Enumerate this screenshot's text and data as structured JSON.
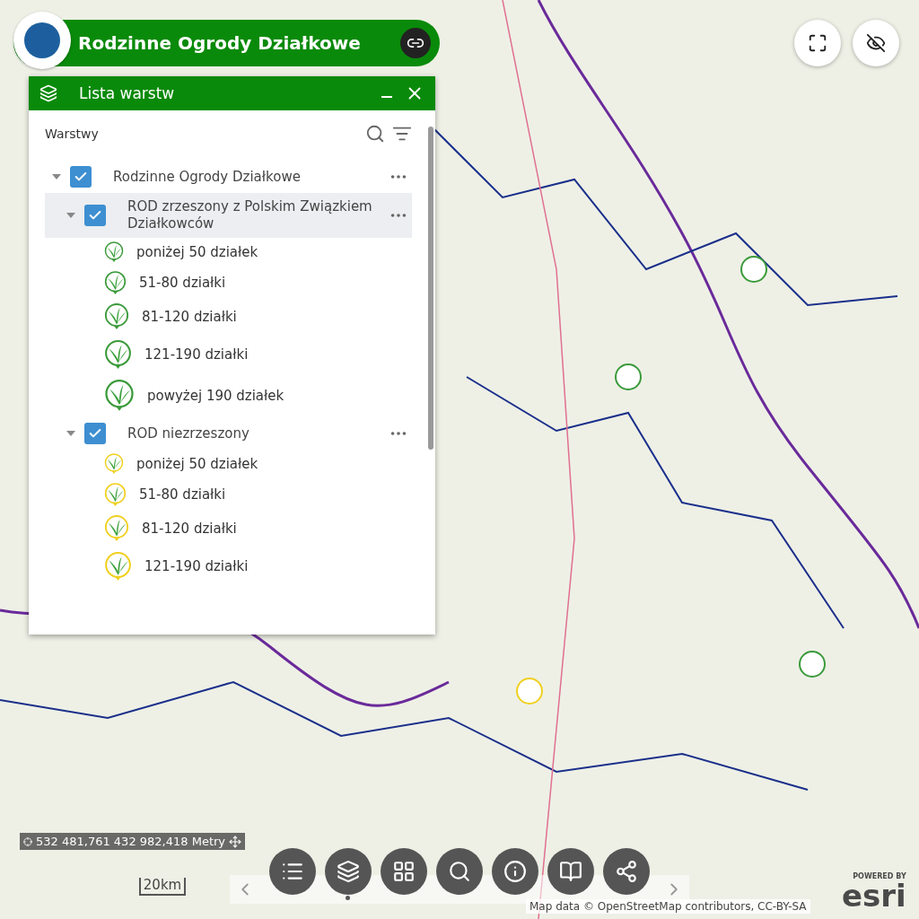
{
  "header": {
    "title": "Rodzinne Ogrody Działkowe"
  },
  "panel": {
    "title": "Lista warstw",
    "section": "Warstwy",
    "layers": [
      {
        "label": "Rodzinne Ogrody Działkowe",
        "checked": true,
        "expanded": true,
        "children": [
          {
            "label": "ROD zrzeszony z Polskim Związkiem Działkowców",
            "checked": true,
            "expanded": true,
            "selected": true,
            "color": "#3a9a3a",
            "legend": [
              "poniżej 50 działek",
              "51-80 działki",
              "81-120 działki",
              "121-190 działki",
              "powyżej 190 działek"
            ]
          },
          {
            "label": "ROD niezrzeszony",
            "checked": true,
            "expanded": true,
            "selected": false,
            "color": "#f0d020",
            "legend": [
              "poniżej 50 działek",
              "51-80 działki",
              "81-120 działki",
              "121-190 działki"
            ]
          }
        ]
      }
    ]
  },
  "coordinates": "532 481,761 432 982,418 Metry",
  "scale": "20km",
  "toolbar": [
    {
      "kind": "list"
    },
    {
      "kind": "layers"
    },
    {
      "kind": "grid"
    },
    {
      "kind": "search"
    },
    {
      "kind": "info"
    },
    {
      "kind": "book"
    },
    {
      "kind": "share"
    }
  ],
  "attribution": "Map data © OpenStreetMap contributors, CC-BY-SA",
  "esri": {
    "top": "POWERED BY",
    "brand": "esri"
  }
}
